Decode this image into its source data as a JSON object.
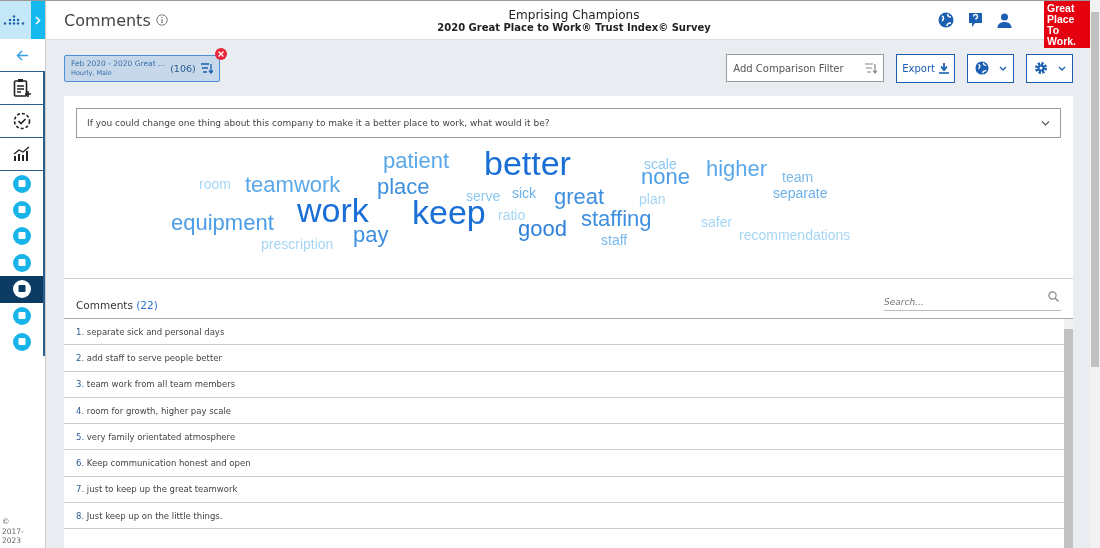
{
  "header": {
    "title": "Comments",
    "company": "Emprising Champions",
    "survey": "2020 Great Place to Work® Trust Index© Survey",
    "logo": [
      "Great",
      "Place",
      "To",
      "Work."
    ]
  },
  "sidebar": {
    "items": [
      {
        "kind": "outline",
        "selected": false
      },
      {
        "kind": "outline",
        "selected": false
      },
      {
        "kind": "outline",
        "selected": false
      },
      {
        "kind": "circle",
        "selected": false
      },
      {
        "kind": "circle",
        "selected": false
      },
      {
        "kind": "circle",
        "selected": false
      },
      {
        "kind": "circle",
        "selected": false
      },
      {
        "kind": "circle",
        "selected": true
      },
      {
        "kind": "circle",
        "selected": false
      },
      {
        "kind": "circle",
        "selected": false
      }
    ],
    "copyright": [
      "©",
      "2017-",
      "2023"
    ]
  },
  "filter_chip": {
    "title": "Feb 2020 - 2020 Great ...",
    "subtitle": "Hourly, Male",
    "count": "(106)"
  },
  "toolbar": {
    "comparison_placeholder": "Add Comparison Filter",
    "export": "Export"
  },
  "question": "If you could change one thing about this company to make it a better place to work, what would it be?",
  "word_cloud": [
    {
      "text": "patient",
      "color": "#5aa8e8"
    },
    {
      "text": "better",
      "color": "#1a6fd6"
    },
    {
      "text": "scale",
      "color": "#8cc8f0"
    },
    {
      "text": "none",
      "color": "#4a9de6"
    },
    {
      "text": "higher",
      "color": "#5aa8e8"
    },
    {
      "text": "team",
      "color": "#7ab9ec"
    },
    {
      "text": "room",
      "color": "#a6d6f5"
    },
    {
      "text": "teamwork",
      "color": "#5aa8e8"
    },
    {
      "text": "place",
      "color": "#3f8fdf"
    },
    {
      "text": "serve",
      "color": "#8cc8f0"
    },
    {
      "text": "sick",
      "color": "#6ab0ea"
    },
    {
      "text": "great",
      "color": "#3f8fdf"
    },
    {
      "text": "plan",
      "color": "#a6d6f5"
    },
    {
      "text": "separate",
      "color": "#6ab0ea"
    },
    {
      "text": "equipment",
      "color": "#4a9de6"
    },
    {
      "text": "work",
      "color": "#1a6fd6"
    },
    {
      "text": "keep",
      "color": "#1a6fd6"
    },
    {
      "text": "ratio",
      "color": "#a6d6f5"
    },
    {
      "text": "staffing",
      "color": "#3f8fdf"
    },
    {
      "text": "prescription",
      "color": "#a6d6f5"
    },
    {
      "text": "pay",
      "color": "#3f8fdf"
    },
    {
      "text": "good",
      "color": "#2f80da"
    },
    {
      "text": "staff",
      "color": "#7ab9ec"
    },
    {
      "text": "safer",
      "color": "#a6d6f5"
    },
    {
      "text": "recommendations",
      "color": "#a6d6f5"
    }
  ],
  "comments": {
    "title": "Comments",
    "count": "(22)",
    "search_placeholder": "Search...",
    "rows": [
      {
        "number": "1.",
        "text": "separate sick and personal days"
      },
      {
        "number": "2.",
        "text": "add staff to serve people better"
      },
      {
        "number": "3.",
        "text": "team work from all team members"
      },
      {
        "number": "4.",
        "text": "room for growth, higher pay scale"
      },
      {
        "number": "5.",
        "text": "very family orientated atmosphere"
      },
      {
        "number": "6.",
        "text": "Keep communication honest and open"
      },
      {
        "number": "7.",
        "text": "just to keep up the great teamwork"
      },
      {
        "number": "8.",
        "text": "Just keep up on the little things."
      }
    ]
  }
}
